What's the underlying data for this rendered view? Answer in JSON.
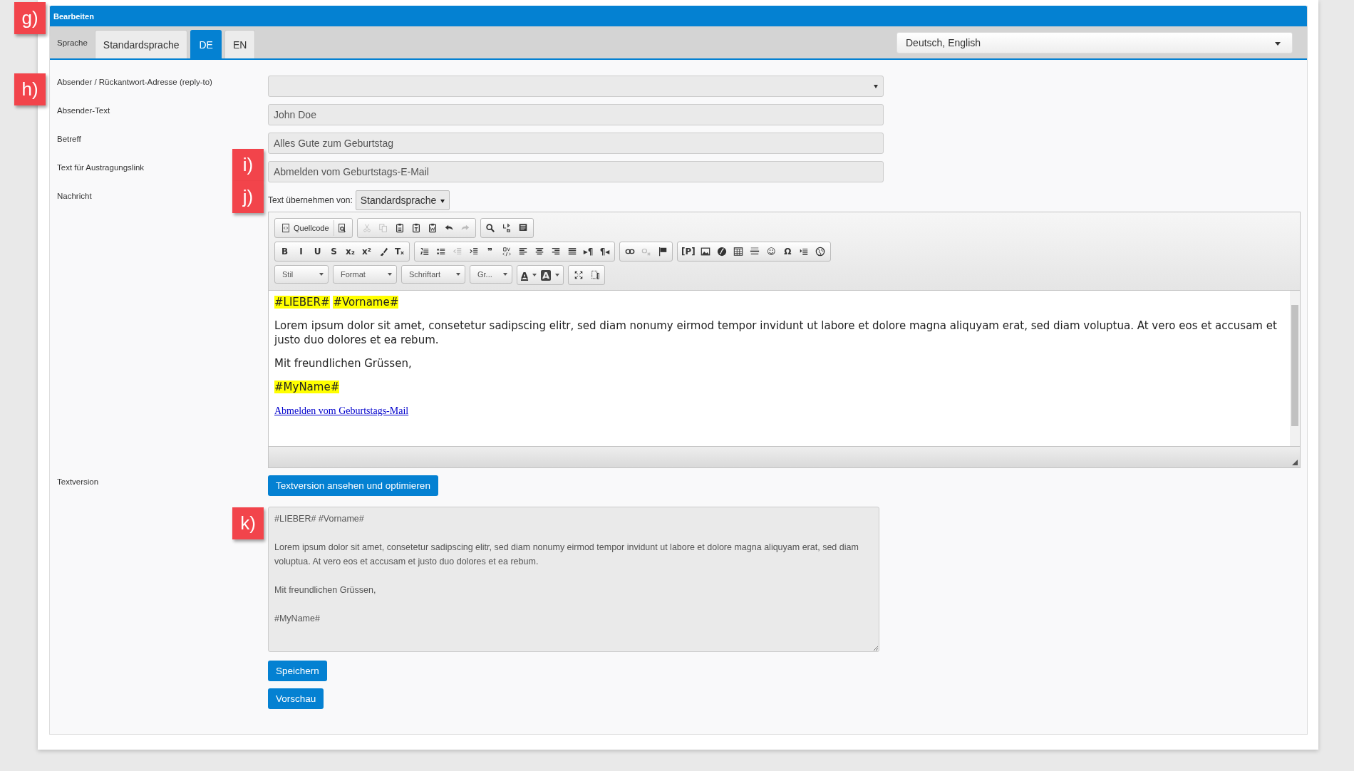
{
  "header": {
    "title": "Bearbeiten"
  },
  "language_bar": {
    "label": "Sprache",
    "tabs": [
      {
        "label": "Standardsprache",
        "selected": false
      },
      {
        "label": "DE",
        "selected": true
      },
      {
        "label": "EN",
        "selected": false
      }
    ],
    "languages": "Deutsch, English"
  },
  "fields": [
    {
      "label": "Absender / Rückantwort-Adresse (reply-to)",
      "kind": "select"
    },
    {
      "label": "Absender-Text",
      "kind": "input",
      "value": "John Doe"
    },
    {
      "label": "Betreff",
      "kind": "input",
      "value": "Alles Gute zum Geburtstag"
    },
    {
      "label": "Text für Austragungslink",
      "kind": "input",
      "value": "Abmelden vom Geburtstags-E-Mail"
    }
  ],
  "message": {
    "label": "Nachricht",
    "copy_label": "Text übernehmen von:",
    "copy_from": "Standardsprache",
    "toolbar": [
      [
        [
          {
            "kind": "labeled",
            "label": "Quellcode",
            "disabled": false
          },
          {
            "kind": "icon",
            "disabled": false
          }
        ],
        [
          {
            "kind": "icon",
            "disabled": true
          },
          {
            "kind": "icon",
            "disabled": true
          },
          {
            "kind": "icon",
            "disabled": false
          },
          {
            "kind": "icon",
            "disabled": false
          },
          {
            "kind": "icon",
            "disabled": false
          },
          {
            "kind": "icon",
            "disabled": false
          },
          {
            "kind": "icon",
            "disabled": true
          }
        ],
        [
          {
            "kind": "icon",
            "disabled": false
          },
          {
            "kind": "icon",
            "disabled": false
          },
          {
            "kind": "icon",
            "disabled": false
          }
        ]
      ],
      [
        [
          {
            "kind": "glyph",
            "glyph": "B",
            "disabled": false
          },
          {
            "kind": "glyph",
            "glyph": "I",
            "disabled": false
          },
          {
            "kind": "glyph",
            "glyph": "U",
            "disabled": false
          },
          {
            "kind": "glyph",
            "glyph": "S",
            "disabled": false
          },
          {
            "kind": "glyph",
            "glyph": "x₂",
            "disabled": false
          },
          {
            "kind": "glyph",
            "glyph": "x²",
            "disabled": false
          },
          {
            "kind": "icon",
            "disabled": false
          },
          {
            "kind": "glyph",
            "glyph": "Tₓ",
            "disabled": false
          }
        ],
        [
          {
            "kind": "icon",
            "disabled": false
          },
          {
            "kind": "icon",
            "disabled": false
          },
          {
            "kind": "icon",
            "disabled": true
          },
          {
            "kind": "icon",
            "disabled": false
          },
          {
            "kind": "glyph",
            "glyph": "❞",
            "disabled": false
          },
          {
            "kind": "icon",
            "disabled": false
          },
          {
            "kind": "icon",
            "disabled": false
          },
          {
            "kind": "icon",
            "disabled": false
          },
          {
            "kind": "icon",
            "disabled": false
          },
          {
            "kind": "icon",
            "disabled": false
          },
          {
            "kind": "glyph",
            "glyph": "▸¶",
            "disabled": false
          },
          {
            "kind": "glyph",
            "glyph": "¶◂",
            "disabled": false
          }
        ],
        [
          {
            "kind": "icon",
            "disabled": false
          },
          {
            "kind": "icon",
            "disabled": true
          },
          {
            "kind": "icon",
            "disabled": false
          }
        ],
        [
          {
            "kind": "glyph",
            "glyph": "[P]",
            "disabled": false
          },
          {
            "kind": "icon",
            "disabled": false
          },
          {
            "kind": "icon",
            "disabled": false
          },
          {
            "kind": "icon",
            "disabled": false
          },
          {
            "kind": "icon",
            "disabled": false
          },
          {
            "kind": "glyph",
            "glyph": "☺",
            "disabled": false
          },
          {
            "kind": "glyph",
            "glyph": "Ω",
            "disabled": false
          },
          {
            "kind": "icon",
            "disabled": false
          },
          {
            "kind": "icon",
            "disabled": false
          }
        ]
      ],
      [
        [
          {
            "kind": "dropdown",
            "label": "Stil",
            "disabled": false
          },
          {
            "kind": "dropdown",
            "label": "Format",
            "disabled": false
          },
          {
            "kind": "dropdown",
            "label": "Schriftart",
            "disabled": false
          },
          {
            "kind": "dropdown",
            "label": "Gr...",
            "disabled": false
          }
        ],
        [
          {
            "kind": "color",
            "glyph": "A",
            "disabled": false
          },
          {
            "kind": "color",
            "glyph": "A",
            "disabled": false
          }
        ],
        [
          {
            "kind": "icon",
            "disabled": false
          },
          {
            "kind": "icon",
            "disabled": false
          }
        ]
      ]
    ],
    "content": [
      {
        "kind": "tags",
        "tags": [
          "#LIEBER#",
          "#Vorname#"
        ]
      },
      {
        "kind": "text",
        "text": "Lorem ipsum dolor sit amet, consetetur sadipscing elitr, sed diam nonumy eirmod tempor invidunt ut labore et dolore magna aliquyam erat, sed diam voluptua. At vero eos et accusam et justo duo dolores et ea rebum."
      },
      {
        "kind": "text",
        "text": "Mit freundlichen Grüssen,"
      },
      {
        "kind": "tags",
        "tags": [
          "#MyName#"
        ]
      },
      {
        "kind": "link",
        "text": "Abmelden vom Geburtstags-Mail"
      }
    ]
  },
  "text_version": {
    "label": "Textversion",
    "button": "Textversion ansehen und optimieren",
    "paragraphs": [
      "#LIEBER# #Vorname#",
      "Lorem ipsum dolor sit amet, consetetur sadipscing elitr, sed diam nonumy eirmod tempor invidunt ut labore et dolore magna aliquyam erat, sed diam voluptua. At vero eos et accusam et justo duo dolores et ea rebum.",
      "Mit freundlichen Grüssen,",
      "#MyName#"
    ]
  },
  "buttons": [
    "Speichern",
    "Vorschau"
  ],
  "annotations": [
    "g)",
    "h)",
    "i)",
    "j)",
    "k)"
  ]
}
